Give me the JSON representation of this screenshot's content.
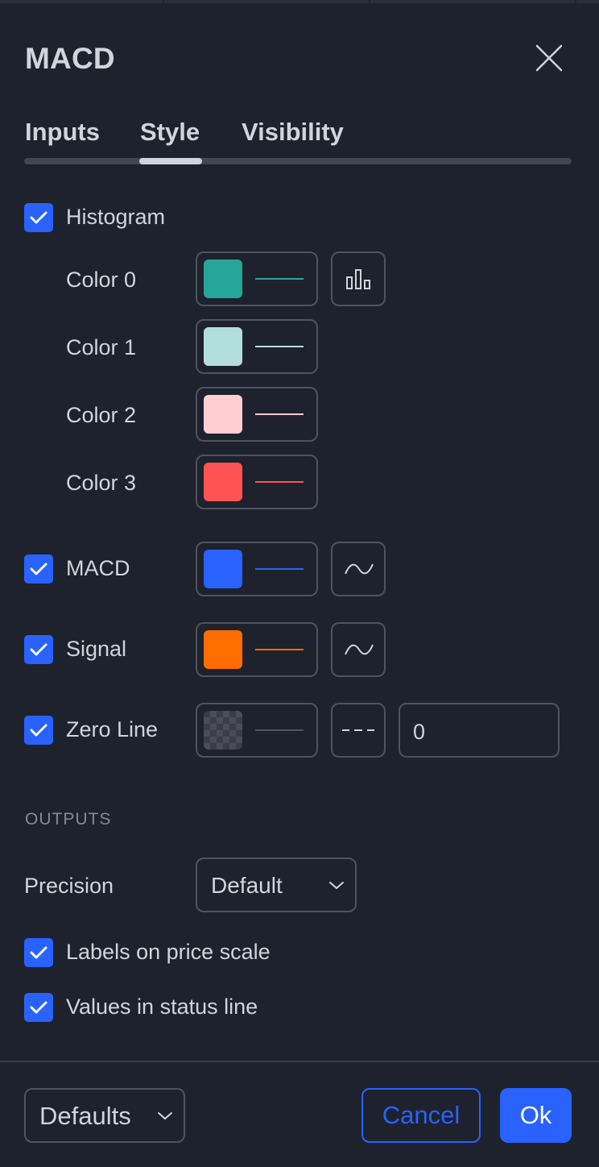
{
  "dialog": {
    "title": "MACD"
  },
  "tabs": [
    {
      "label": "Inputs"
    },
    {
      "label": "Style",
      "active": true
    },
    {
      "label": "Visibility"
    }
  ],
  "histogram": {
    "label": "Histogram",
    "checked": true,
    "colors": [
      {
        "label": "Color 0",
        "color": "#26a69a"
      },
      {
        "label": "Color 1",
        "color": "#b2dfdb"
      },
      {
        "label": "Color 2",
        "color": "#ffcdd2"
      },
      {
        "label": "Color 3",
        "color": "#ff5252"
      }
    ],
    "plot_style_icon": "histogram-icon"
  },
  "plots": [
    {
      "label": "MACD",
      "checked": true,
      "color": "#2962ff",
      "style_icon": "line-icon"
    },
    {
      "label": "Signal",
      "checked": true,
      "color": "#ff6d00",
      "style_icon": "line-icon"
    }
  ],
  "zero_line": {
    "label": "Zero Line",
    "checked": true,
    "color": "transparent",
    "style_icon": "dashed-line-icon",
    "value": "0"
  },
  "outputs": {
    "section_title": "OUTPUTS",
    "precision_label": "Precision",
    "precision_value": "Default",
    "labels_on_price_scale": {
      "label": "Labels on price scale",
      "checked": true
    },
    "values_in_status_line": {
      "label": "Values in status line",
      "checked": true
    }
  },
  "footer": {
    "defaults_label": "Defaults",
    "cancel_label": "Cancel",
    "ok_label": "Ok"
  },
  "theme": {
    "accent": "#2962ff",
    "background": "#1e222d",
    "text": "#d1d4dc"
  }
}
